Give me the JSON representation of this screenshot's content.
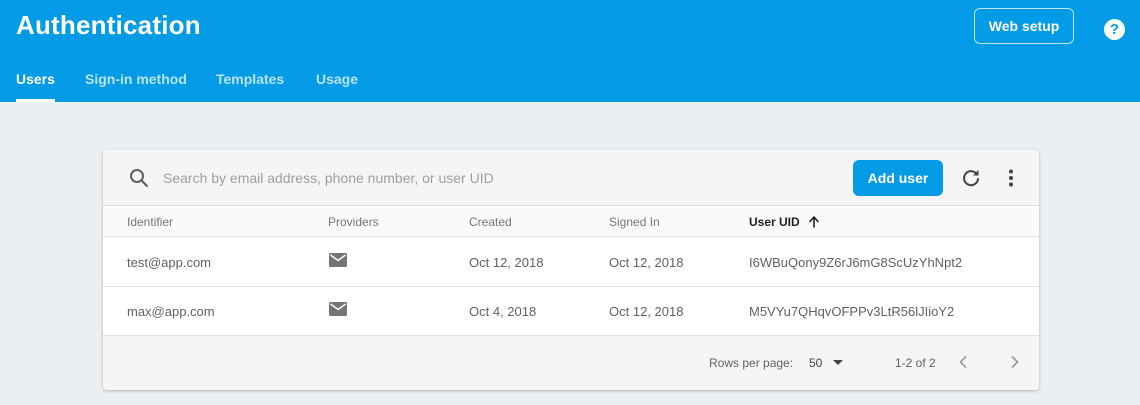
{
  "app": {
    "title": "Authentication",
    "web_setup_label": "Web setup",
    "help_icon": "help-circle-icon",
    "help_glyph": "?"
  },
  "tabs": [
    {
      "label": "Users",
      "active": true
    },
    {
      "label": "Sign-in method",
      "active": false
    },
    {
      "label": "Templates",
      "active": false
    },
    {
      "label": "Usage",
      "active": false
    }
  ],
  "toolbar": {
    "search_placeholder": "Search by email address, phone number, or user UID",
    "search_value": "",
    "add_user_label": "Add user",
    "icons": [
      "search-icon",
      "refresh-icon",
      "more-vert-icon"
    ]
  },
  "table": {
    "columns": [
      "Identifier",
      "Providers",
      "Created",
      "Signed In",
      "User UID"
    ],
    "sorted_column": "User UID",
    "sort_direction": "ascending",
    "rows": [
      {
        "identifier": "test@app.com",
        "provider": "email-icon",
        "created": "Oct 12, 2018",
        "signed_in": "Oct 12, 2018",
        "uid": "I6WBuQony9Z6rJ6mG8ScUzYhNpt2"
      },
      {
        "identifier": "max@app.com",
        "provider": "email-icon",
        "created": "Oct 4, 2018",
        "signed_in": "Oct 12, 2018",
        "uid": "M5VYu7QHqvOFPPv3LtR56lJIioY2"
      }
    ]
  },
  "pagination": {
    "rows_per_page_label": "Rows per page:",
    "rows_per_page": "50",
    "range": "1-2 of 2"
  },
  "colors": {
    "brand": "#039be5",
    "background": "#eceff1"
  }
}
